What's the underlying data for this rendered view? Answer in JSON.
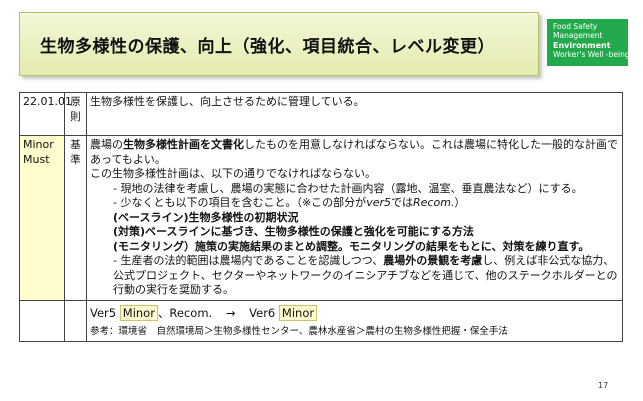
{
  "title": "生物多様性の保護、向上（強化、項目統合、レベル変更）",
  "categories": {
    "items": [
      "Food Safety",
      "Management",
      "Environment",
      "Worker's Well -being"
    ],
    "active": "Environment",
    "color": "#22a94c"
  },
  "row1": {
    "code": "22.01.01",
    "type": "原則",
    "text": "生物多様性を保護し、向上させるために管理している。"
  },
  "row2": {
    "level": "Minor Must",
    "level_color": "#fefccc",
    "type": "基準",
    "l1_pre": "農場の",
    "l1_bold": "生物多様性計画を文書化",
    "l1_post": "したものを用意しなければならない。これは農場に特化した一般的な計画であってもよい。",
    "l2": "この生物多様性計画は、以下の通りでなければならない。",
    "l3": "- 現地の法律を考慮し、農場の実態に合わせた計画内容（露地、温室、垂直農法など）にする。",
    "l4_pre": "- 少なくとも以下の項目を含むこと。（※この部分が",
    "l4_ital": "ver5",
    "l4_mid": "では",
    "l4_ital2": "Recom.",
    "l4_post": "）",
    "l5": "(ベースライン)生物多様性の初期状況",
    "l6": "(対策)ベースラインに基づき、生物多様性の保護と強化を可能にする方法",
    "l7": "(モニタリング）施策の実施結果のまとめ調整。モニタリングの結果をもとに、対策を練り直す。",
    "l8_pre": "- 生産者の法的範囲は農場内であることを認識しつつ、",
    "l8_bold": "農場外の景観を考慮",
    "l8_post": "し、例えば非公式な協力、公式プロジェクト、セクターやネットワークのイニシアチブなどを通じて、他のステークホルダーとの行動の実行を奨励する。"
  },
  "row3": {
    "v5_label": "Ver5",
    "v5_level": "Minor",
    "v5_sep": "、Recom.",
    "arrow": "→",
    "v6_label": "Ver6",
    "v6_level": "Minor",
    "reference": "参考：環境省　自然環境局＞生物多様性センター、農林水産省＞農村の生物多様性把握・保全手法"
  },
  "page_number": "17"
}
